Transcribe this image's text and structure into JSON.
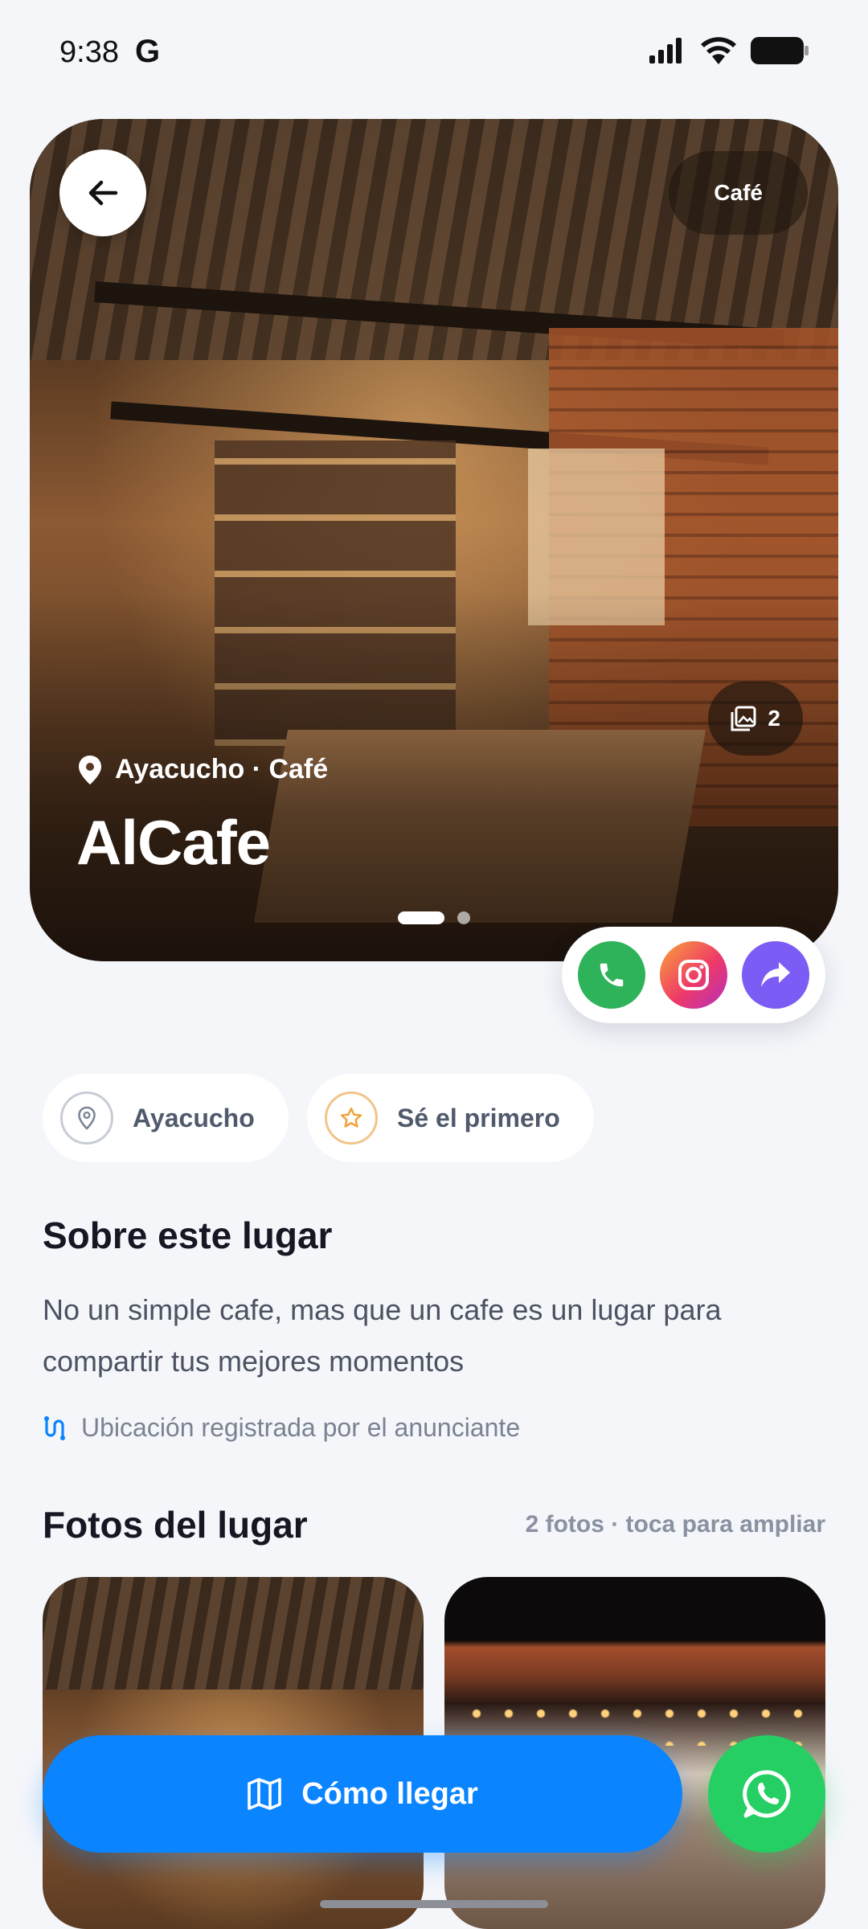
{
  "status_bar": {
    "time": "9:38",
    "carrier_glyph": "G",
    "icons": [
      "signal-icon",
      "wifi-icon",
      "battery-icon"
    ]
  },
  "hero": {
    "category_badge": "Café",
    "photo_count": "2",
    "location_line": "Ayacucho · Café",
    "title": "AlCafe",
    "carousel_pages": 2,
    "carousel_active_index": 0
  },
  "actions": {
    "icons": [
      "phone-icon",
      "instagram-icon",
      "share-icon"
    ],
    "colors": {
      "phone": "#2fb35a",
      "share": "#7b5cf5"
    }
  },
  "chips": {
    "location": "Ayacucho",
    "rating": "Sé el primero"
  },
  "about": {
    "title": "Sobre este lugar",
    "text": "No un simple cafe, mas que un cafe es un lugar para compartir tus mejores momentos",
    "location_note": "Ubicación registrada por el anunciante"
  },
  "photos": {
    "title": "Fotos del lugar",
    "hint": "2 fotos · toca para ampliar"
  },
  "bottom_bar": {
    "directions_label": "Cómo llegar",
    "accent_color": "#0a84ff",
    "whatsapp_color": "#25cf63"
  }
}
